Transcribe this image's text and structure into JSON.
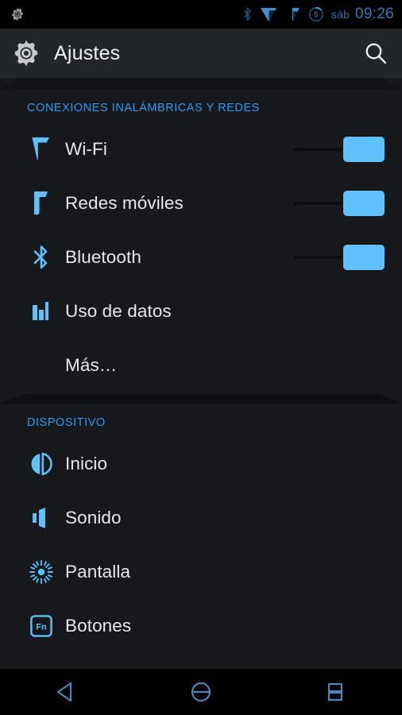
{
  "status_bar": {
    "notification_icon": "settings-gear-icon",
    "icons": [
      "bluetooth-icon",
      "wifi-signal-icon",
      "cellular-signal-icon",
      "battery-icon"
    ],
    "battery_label": "5",
    "day": "sáb",
    "time": "09:26",
    "colors": {
      "accent": "#2f7bc0",
      "background": "#000000"
    }
  },
  "action_bar": {
    "icon": "settings-gear-icon",
    "title": "Ajustes",
    "search_icon": "search-icon",
    "background": "#232629"
  },
  "sections": [
    {
      "header": "CONEXIONES INALÁMBRICAS Y REDES",
      "rows": [
        {
          "icon": "wifi-icon",
          "label": "Wi-Fi",
          "has_switch": true,
          "switch_on": true
        },
        {
          "icon": "cellular-icon",
          "label": "Redes móviles",
          "has_switch": true,
          "switch_on": true
        },
        {
          "icon": "bluetooth-icon",
          "label": "Bluetooth",
          "has_switch": true,
          "switch_on": true
        },
        {
          "icon": "data-usage-icon",
          "label": "Uso de datos",
          "has_switch": false,
          "switch_on": false
        },
        {
          "icon": "none",
          "label": "Más…",
          "has_switch": false,
          "switch_on": false
        }
      ]
    },
    {
      "header": "DISPOSITIVO",
      "rows": [
        {
          "icon": "home-icon",
          "label": "Inicio",
          "has_switch": false,
          "switch_on": false
        },
        {
          "icon": "sound-icon",
          "label": "Sonido",
          "has_switch": false,
          "switch_on": false
        },
        {
          "icon": "brightness-icon",
          "label": "Pantalla",
          "has_switch": false,
          "switch_on": false
        },
        {
          "icon": "fn-key-icon",
          "label": "Botones",
          "has_switch": false,
          "switch_on": false
        }
      ]
    }
  ],
  "nav_bar": {
    "buttons": [
      {
        "icon": "back-icon",
        "name": "back"
      },
      {
        "icon": "home-icon",
        "name": "home"
      },
      {
        "icon": "recents-icon",
        "name": "recents"
      }
    ],
    "color": "#4a86b8"
  },
  "theme": {
    "background": "#16181c",
    "accent_blue": "#2a9df4",
    "icon_blue": "#5ec1fb",
    "text_primary": "#e9e9e9"
  }
}
